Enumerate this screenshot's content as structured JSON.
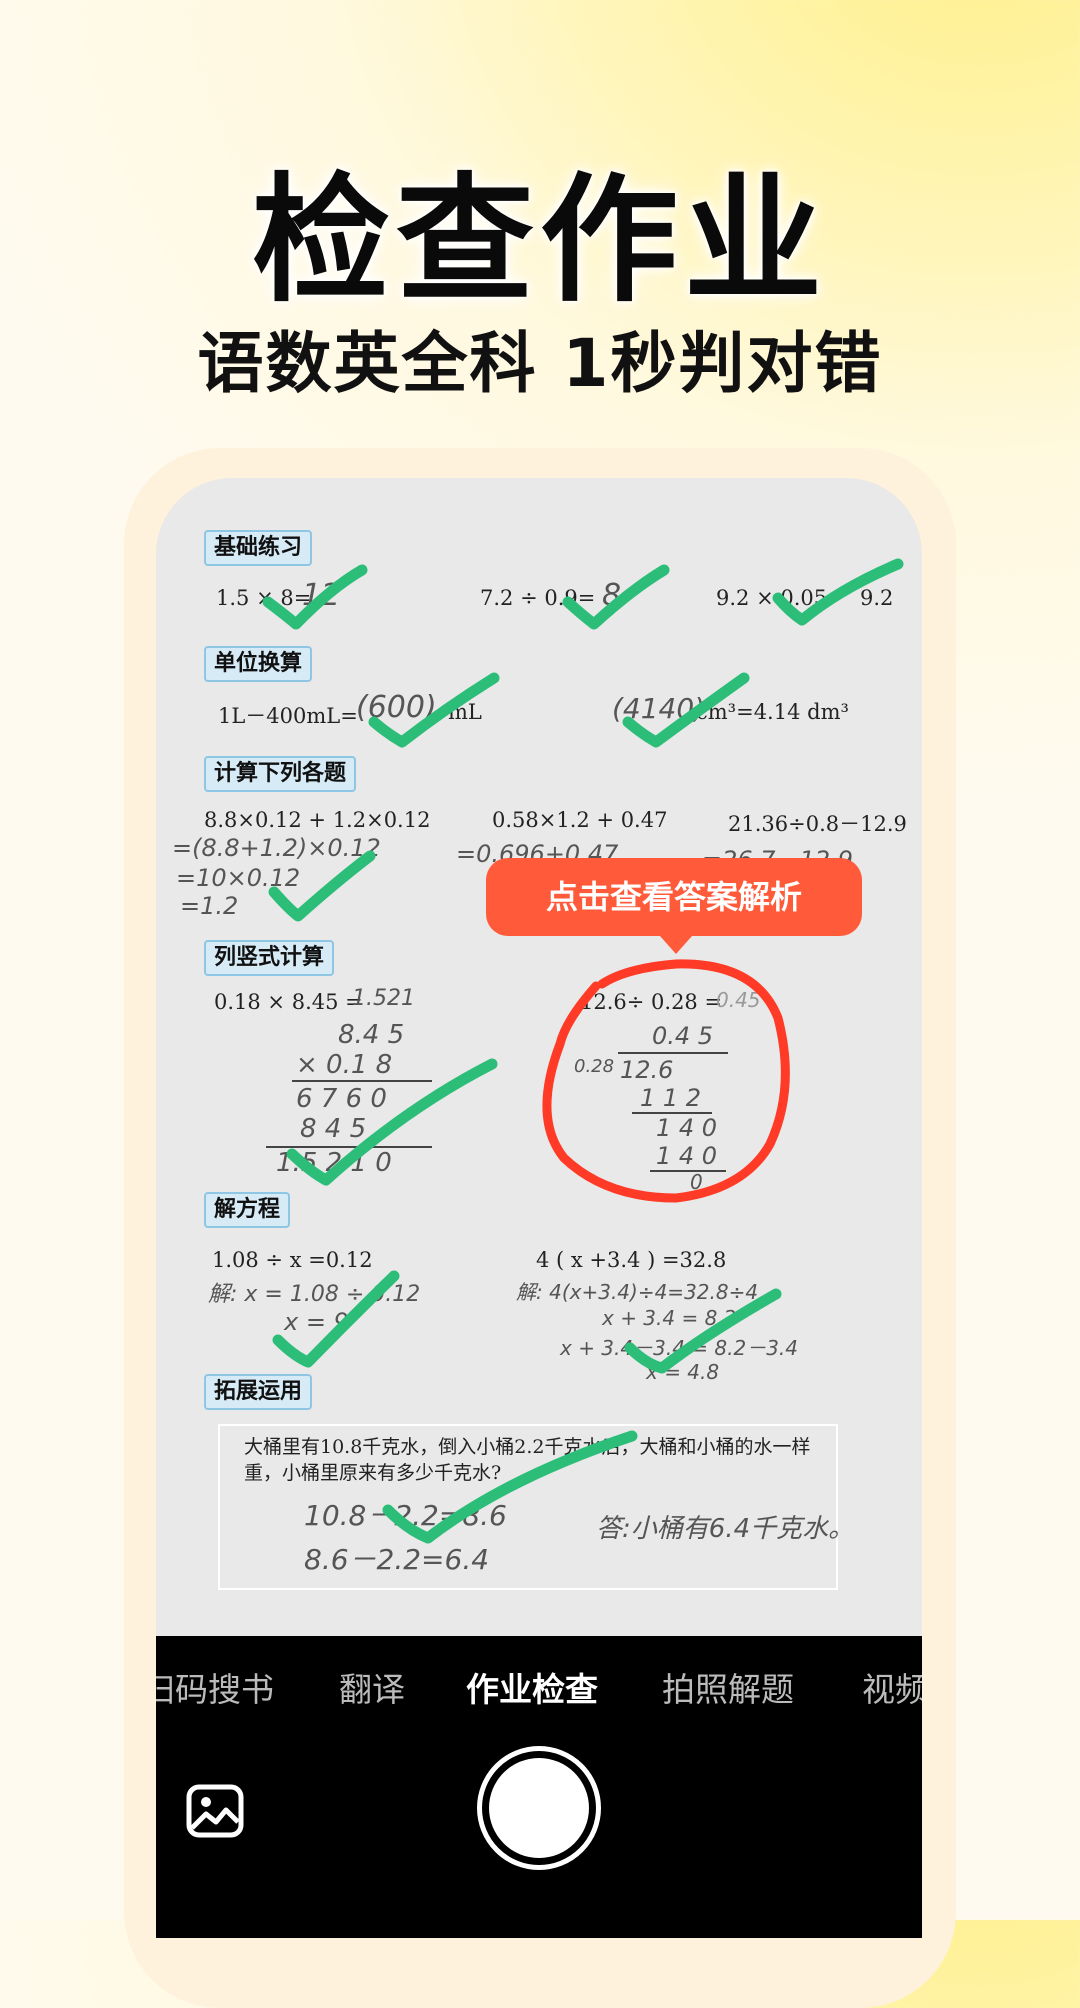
{
  "headline": "检查作业",
  "subline": "语数英全科 1秒判对错",
  "colors": {
    "check": "#2cbe78",
    "circle": "#ff3a26",
    "tooltip": "#ff5a3a",
    "label_bg": "#d6ebf6"
  },
  "worksheet": {
    "sections": {
      "basic": "基础练习",
      "units": "单位换算",
      "compute": "计算下列各题",
      "vertical": "列竖式计算",
      "equation": "解方程",
      "application": "拓展运用"
    },
    "basic_q1": "1.5 × 8=",
    "basic_a1": "12",
    "basic_q2": "7.2 ÷ 0.9=",
    "basic_a2": "8",
    "basic_q3": "9.2 × 0.05",
    "basic_q3_end": "9.2",
    "units_q1": "1L－400mL=",
    "units_a1": "(600)",
    "units_q1_end": "mL",
    "units_a2": "(4140)",
    "units_q2_end": "cm³=4.14 dm³",
    "compute_q1": "8.8×0.12 + 1.2×0.12",
    "compute_q2": "0.58×1.2 + 0.47",
    "compute_q3": "21.36÷0.8－12.9",
    "compute_w1": "=(8.8+1.2)×0.12",
    "compute_w2": "=10×0.12",
    "compute_w3": "=1.2",
    "compute_w4": "=0.696+0.47",
    "compute_w5": "=26.7－12.9",
    "vertical_q1": "0.18 × 8.45 =",
    "vertical_a1": "1.521",
    "vertical_w1": "8.4 5",
    "vertical_w2": "× 0.1 8",
    "vertical_w3": "6 7 6 0",
    "vertical_w4": "8 4 5",
    "vertical_w5": "1.5 2 1 0",
    "vertical_q2": "12.6÷ 0.28 =",
    "vertical_a2": "0.45",
    "vertical_d1": "0.4 5",
    "vertical_d2": "0.28",
    "vertical_d3": "12.6",
    "vertical_d4": "1 1 2",
    "vertical_d5": "1 4 0",
    "vertical_d6": "1 4 0",
    "vertical_d7": "0",
    "equation_q1": "1.08 ÷ x =0.12",
    "equation_w1": "解:  x = 1.08 ÷ 0.12",
    "equation_w2": "x = 9",
    "equation_q2": "4 ( x +3.4 ) =32.8",
    "equation_w3": "解: 4(x+3.4)÷4=32.8÷4",
    "equation_w4": "x + 3.4 = 8.2",
    "equation_w5": "x + 3.4－3.4 = 8.2－3.4",
    "equation_w6": "x = 4.8",
    "app_q_line1": "大桶里有10.8千克水，倒入小桶2.2千克水后，大桶和小桶的水一样",
    "app_q_line2": "重，小桶里原来有多少千克水?",
    "app_w1": "10.8－2.2=8.6",
    "app_w2": "8.6－2.2=6.4",
    "app_answer": "答:小桶有6.4千克水。"
  },
  "tooltip": "点击查看答案解析",
  "camera": {
    "tabs": [
      "扫码搜书",
      "翻译",
      "作业检查",
      "拍照解题",
      "视频"
    ],
    "active_tab": "作业检查"
  }
}
